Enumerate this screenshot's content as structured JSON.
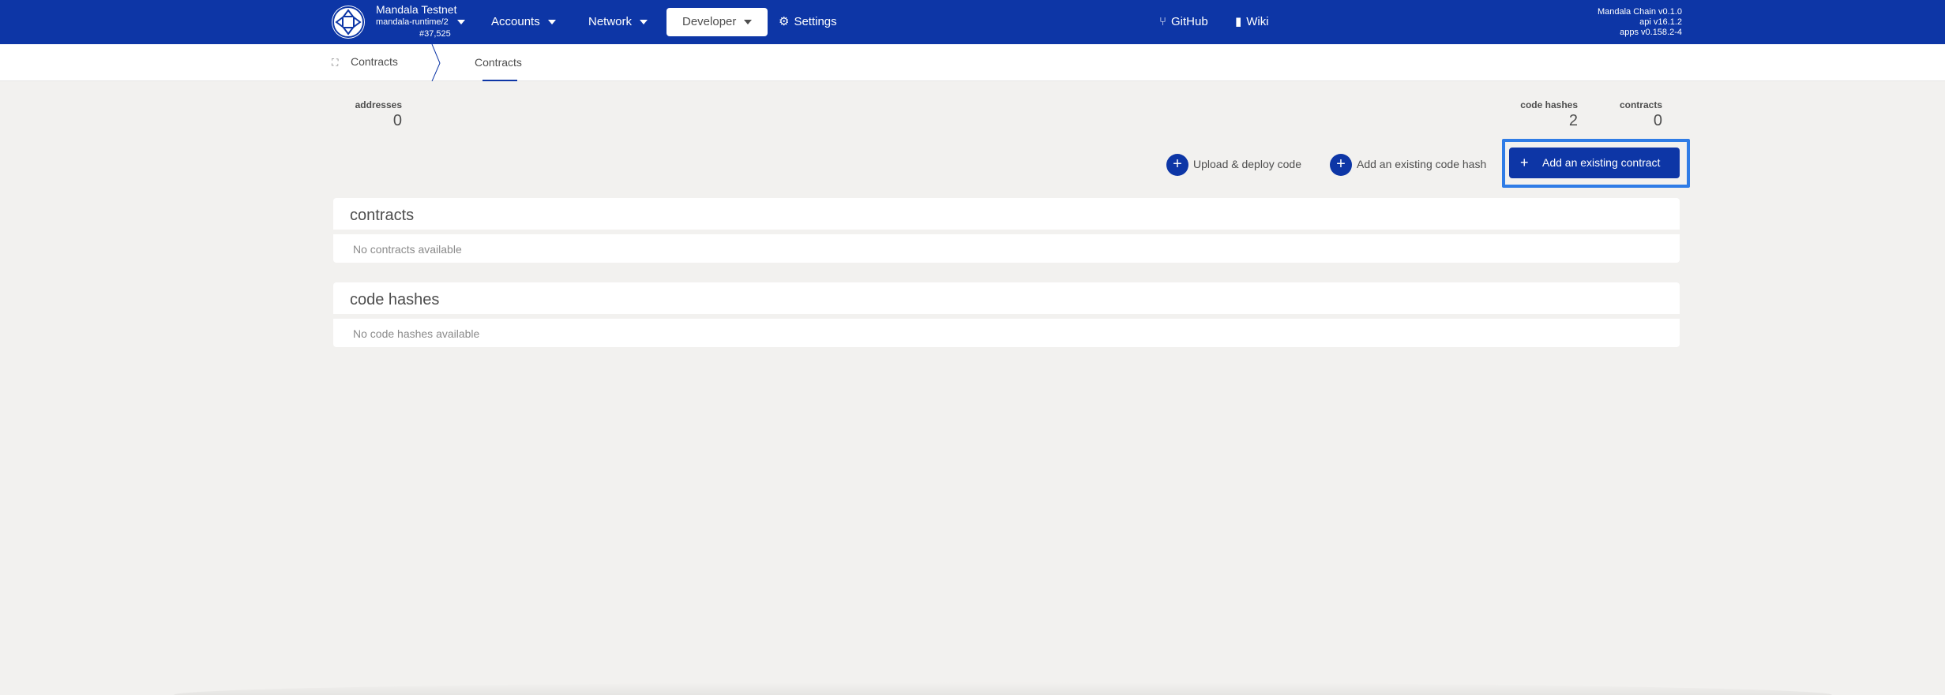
{
  "menubar": {
    "chain_name": "Mandala Testnet",
    "runtime": "mandala-runtime/2",
    "block": "#37,525",
    "items": [
      {
        "label": "Accounts"
      },
      {
        "label": "Network"
      },
      {
        "label": "Developer"
      },
      {
        "label": "Settings"
      }
    ],
    "links": [
      {
        "label": "GitHub"
      },
      {
        "label": "Wiki"
      }
    ],
    "versions": [
      "Mandala Chain v0.1.0",
      "api v16.1.2",
      "apps v0.158.2-4"
    ]
  },
  "tabs": {
    "root_label": "Contracts",
    "active_label": "Contracts"
  },
  "summary": {
    "addresses_label": "addresses",
    "addresses_value": "0",
    "code_hashes_label": "code hashes",
    "code_hashes_value": "2",
    "contracts_label": "contracts",
    "contracts_value": "0"
  },
  "actions": {
    "upload_label": "Upload & deploy code",
    "add_hash_label": "Add an existing code hash",
    "add_contract_label": "Add an existing contract"
  },
  "tables": {
    "contracts_title": "contracts",
    "contracts_empty": "No contracts available",
    "hashes_title": "code hashes",
    "hashes_empty": "No code hashes available"
  },
  "colors": {
    "brand": "#0d36a6",
    "highlight": "#2f7ce6",
    "background": "#f2f1ef"
  }
}
